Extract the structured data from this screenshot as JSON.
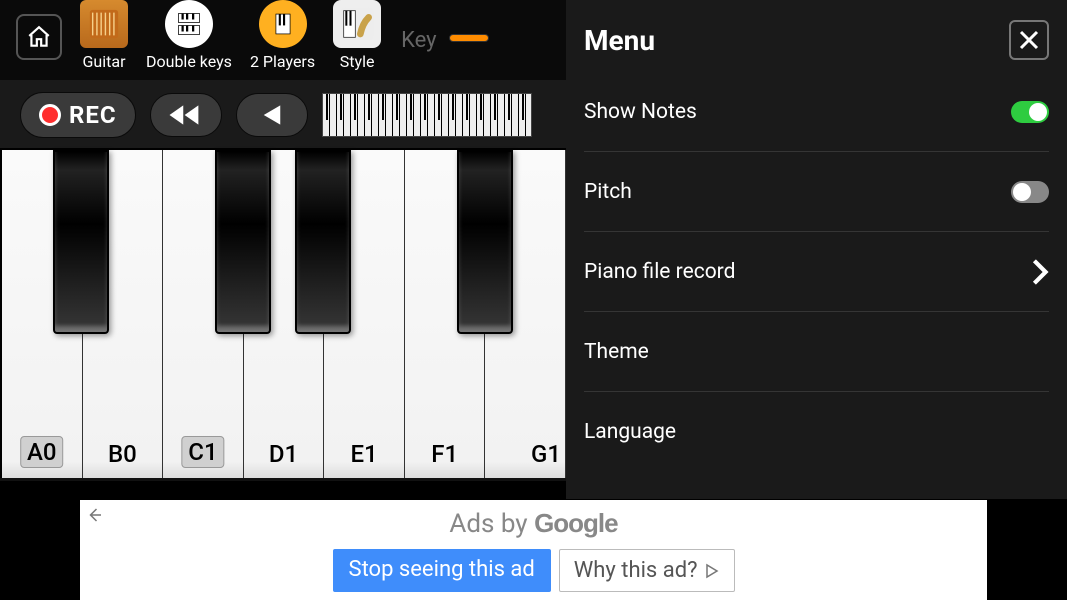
{
  "topbar": {
    "items": [
      {
        "label": "Guitar"
      },
      {
        "label": "Double keys"
      },
      {
        "label": "2 Players"
      },
      {
        "label": "Style"
      }
    ],
    "key_sig_label": "Key"
  },
  "controls": {
    "rec_label": "REC"
  },
  "piano": {
    "white_keys": [
      "A0",
      "B0",
      "C1",
      "D1",
      "E1",
      "F1",
      "G1"
    ],
    "boxed_keys": [
      "A0",
      "C1"
    ]
  },
  "menu": {
    "title": "Menu",
    "items": {
      "show_notes": {
        "label": "Show Notes",
        "on": true
      },
      "pitch": {
        "label": "Pitch",
        "on": false
      },
      "record": {
        "label": "Piano file record"
      },
      "theme": {
        "label": "Theme"
      },
      "language": {
        "label": "Language"
      }
    }
  },
  "ad": {
    "heading_prefix": "Ads by ",
    "heading_brand": "Google",
    "stop_label": "Stop seeing this ad",
    "why_label": "Why this ad?"
  }
}
